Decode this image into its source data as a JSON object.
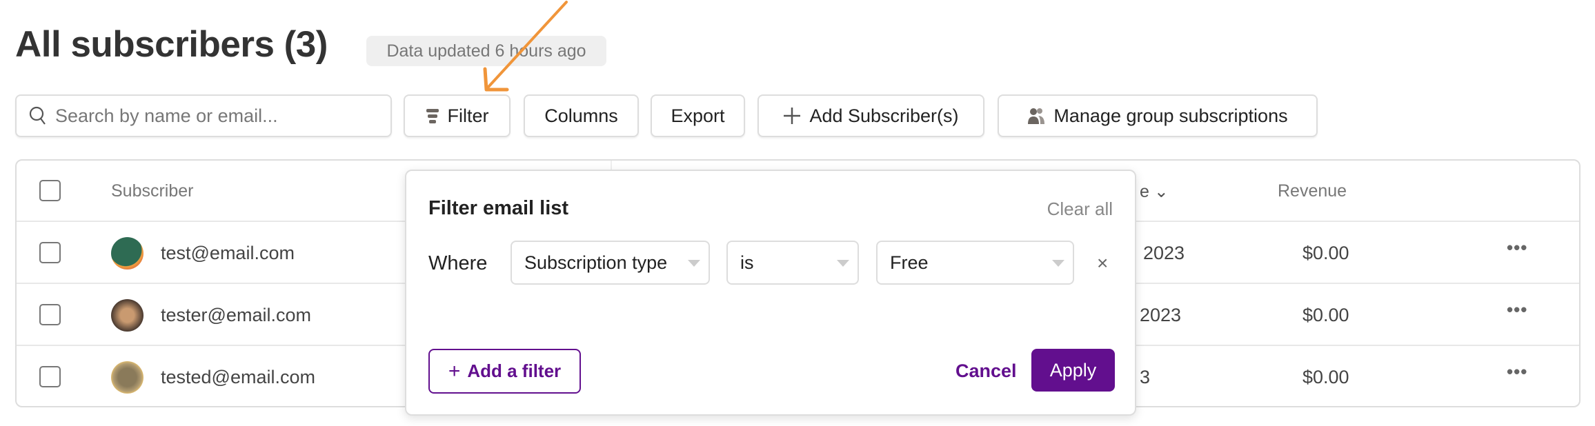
{
  "header": {
    "title": "All subscribers (3)",
    "updated_badge": "Data updated 6 hours ago"
  },
  "toolbar": {
    "search_placeholder": "Search by name or email...",
    "filter": "Filter",
    "columns": "Columns",
    "export": "Export",
    "add_subscriber": "Add Subscriber(s)",
    "manage_groups": "Manage group subscriptions"
  },
  "table": {
    "columns": {
      "subscriber": "Subscriber",
      "date_partial": "e",
      "revenue": "Revenue"
    },
    "rows": [
      {
        "email": "test@email.com",
        "date_partial": "2023",
        "revenue": "$0.00"
      },
      {
        "email": "tester@email.com",
        "date_partial": "2023",
        "revenue": "$0.00"
      },
      {
        "email": "tested@email.com",
        "date_partial": "3",
        "revenue": "$0.00"
      }
    ]
  },
  "filter_popup": {
    "title": "Filter email list",
    "clear_all": "Clear all",
    "where": "Where",
    "field": "Subscription type",
    "operator": "is",
    "value": "Free",
    "remove": "×",
    "add_filter": "Add a filter",
    "cancel": "Cancel",
    "apply": "Apply"
  },
  "colors": {
    "accent": "#620f8e",
    "annotation_arrow": "#f0953a"
  }
}
